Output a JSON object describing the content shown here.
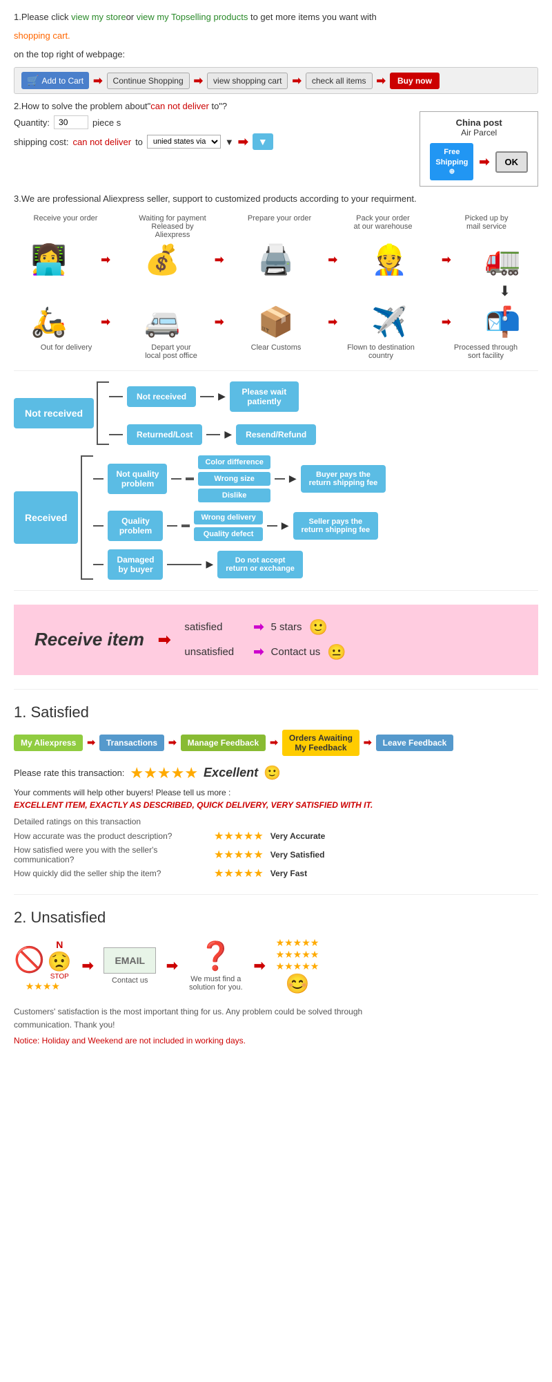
{
  "section1": {
    "text1": "1.Please click ",
    "link1": "view my store",
    "or_text": "or ",
    "link2": "view my Topselling products",
    "text2": " to get more items you want with",
    "text3": "shopping cart.",
    "text4": "on the top right of webpage:",
    "cart_label": "🛒 Add to Cart",
    "arrow1": "➡",
    "btn2": "Continue Shopping",
    "arrow2": "➡",
    "btn3": "view shopping cart",
    "arrow3": "➡",
    "btn4": "check all items",
    "arrow4": "➡",
    "btn5": "Buy now"
  },
  "section2": {
    "title": "2.How to solve the problem about",
    "red1": "can not deliver",
    "text2": " to",
    "qty_label": "Quantity:",
    "qty_value": "30",
    "qty_unit": "piece s",
    "shipping_label": "shipping cost:",
    "red2": "can not deliver",
    "text3": " to ",
    "select_val": "unied states via",
    "china_post_title": "China post",
    "china_post_sub": "Air Parcel",
    "free_shipping_line1": "Free",
    "free_shipping_line2": "Shipping",
    "ok_label": "OK"
  },
  "section3": {
    "text": "3.We are professional Aliexpress seller, support to customized products according to your requirment."
  },
  "process_labels_top": [
    "Receive your order",
    "Waiting for payment\nReleased by Aliexpress",
    "Prepare your order",
    "Pack your order\nat our warehouse",
    "Picked up by\nmail service"
  ],
  "process_labels_bottom": [
    "Out for delivery",
    "Depart your\nlocal post office",
    "Clear Customs",
    "Flown to destination\ncountry",
    "Processed through\nsort facility"
  ],
  "nr_section": {
    "main_label": "Not received",
    "branch1": "Not received",
    "branch1_result": "Please wait\npatiently",
    "branch2": "Returned/Lost",
    "branch2_result": "Resend/Refund"
  },
  "recv_section": {
    "main_label": "Received",
    "nqp_label": "Not quality\nproblem",
    "nqp_items": [
      "Color difference",
      "Wrong size",
      "Dislike"
    ],
    "nqp_result": "Buyer pays the\nreturn shipping fee",
    "qp_label": "Quality\nproblem",
    "qp_items": [
      "Wrong delivery",
      "Quality defect"
    ],
    "qp_result": "Seller pays the\nreturn shipping fee",
    "dmg_label": "Damaged\nby buyer",
    "dmg_result": "Do not accept\nreturn or exchange"
  },
  "pink_section": {
    "title": "Receive item",
    "arrow": "➡",
    "row1_label": "satisfied",
    "row1_arrow": "➡",
    "row1_result": "5 stars",
    "row1_emoji": "🙂",
    "row2_label": "unsatisfied",
    "row2_arrow": "➡",
    "row2_result": "Contact us",
    "row2_emoji": "😐"
  },
  "satisfied": {
    "title": "1. Satisfied",
    "flow": [
      "My Aliexpress",
      "Transactions",
      "Manage Feedback",
      "Orders Awaiting\nMy Feedback",
      "Leave Feedback"
    ],
    "rate_text": "Please rate this transaction:",
    "stars": "★★★★★",
    "excellent": "Excellent",
    "excellent_emoji": "🙂",
    "comments": "Your comments will help other buyers! Please tell us more :",
    "example_comment": "EXCELLENT ITEM, EXACTLY AS DESCRIBED, QUICK DELIVERY, VERY SATISFIED WITH IT.",
    "ratings_title": "Detailed ratings on this transaction",
    "rating1_label": "How accurate was the product description?",
    "rating1_stars": "★★★★★",
    "rating1_result": "Very Accurate",
    "rating2_label": "How satisfied were you with the seller's communication?",
    "rating2_stars": "★★★★★",
    "rating2_result": "Very Satisfied",
    "rating3_label": "How quickly did the seller ship the item?",
    "rating3_stars": "★★★★★",
    "rating3_result": "Very Fast"
  },
  "unsatisfied": {
    "title": "2. Unsatisfied",
    "step1_emoji": "🚫\nN\n😟\n⭐⭐⭐⭐",
    "arrow1": "➡",
    "step2_label": "EMAIL",
    "step2_sublabel": "Contact us",
    "arrow2": "➡",
    "step3_emoji": "❓",
    "step3_sublabel": "We must find\na solution for\nyou.",
    "arrow3": "➡",
    "step4_stars1": "★★★★★",
    "step4_stars2": "★★★★★",
    "step4_stars3": "★★★★★",
    "step4_emoji": "😊",
    "footer1": "Customers' satisfaction is the most important thing for us. Any problem could be solved through",
    "footer2": "communication. Thank you!",
    "notice": "Notice: Holiday and Weekend are not included in working days."
  },
  "colors": {
    "blue_box": "#5bbce4",
    "green_btn": "#90cc40",
    "red": "#cc0000",
    "yellow": "#ffcc00",
    "orange": "#ff6600",
    "pink_bg": "#ffcce0"
  }
}
